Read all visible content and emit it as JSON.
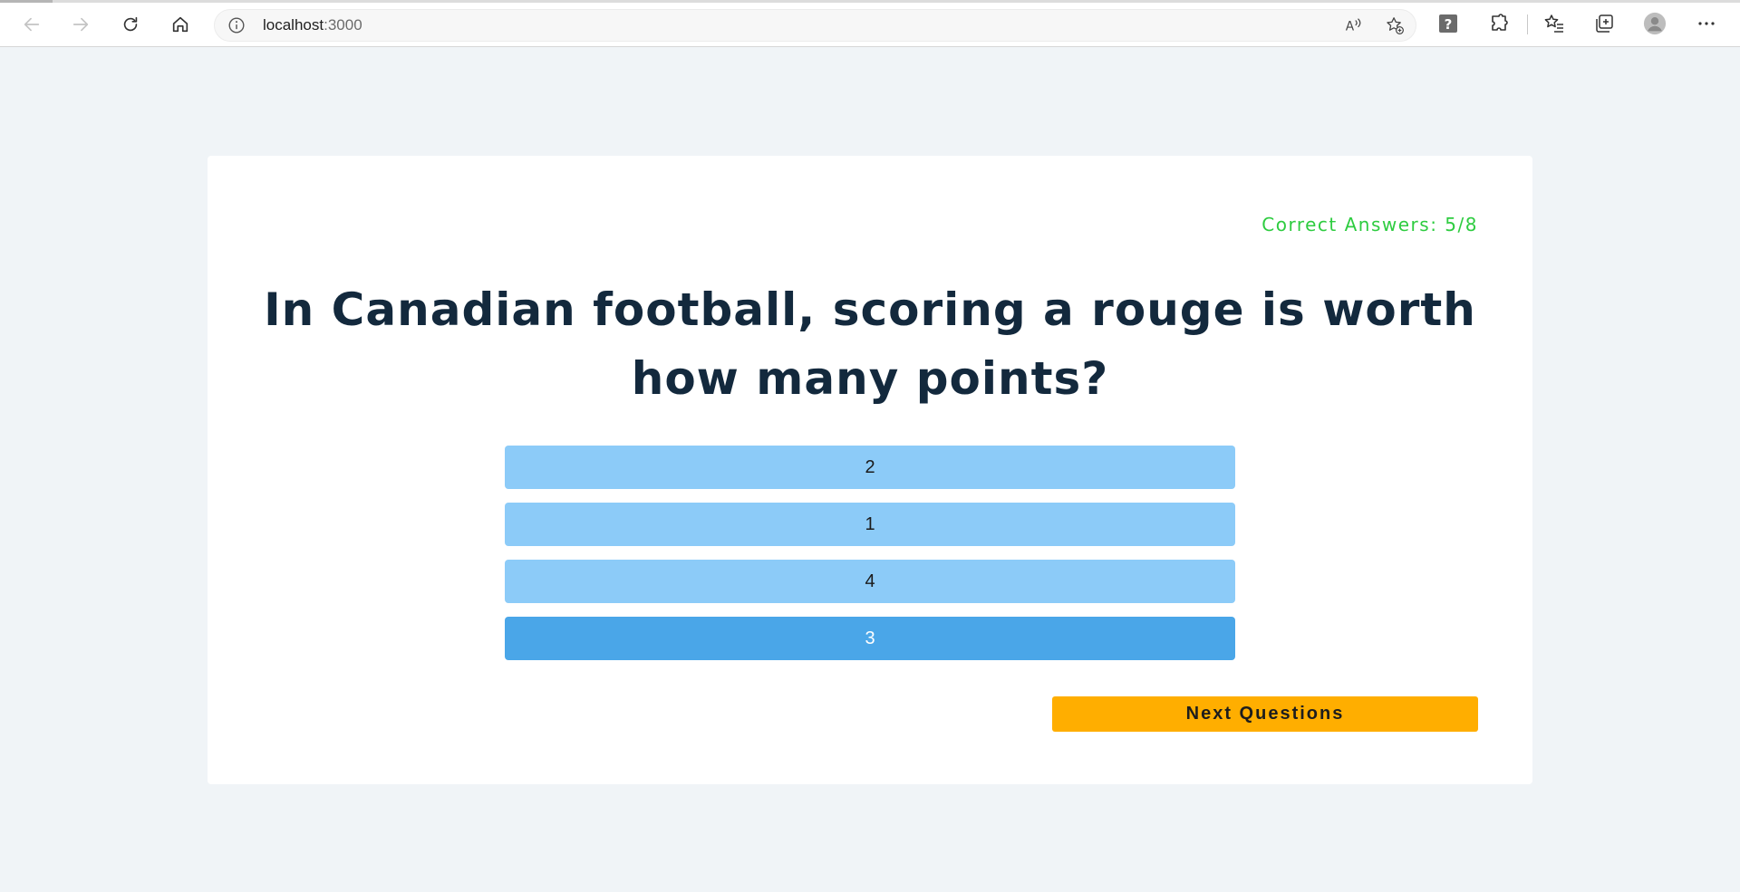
{
  "browser": {
    "url_host": "localhost",
    "url_port": ":3000",
    "icons": {
      "back": "back-arrow-icon",
      "forward": "forward-arrow-icon",
      "refresh": "refresh-icon",
      "home": "home-icon",
      "info": "info-icon",
      "read_aloud": "read-aloud-icon",
      "add_favorite": "add-favorite-icon",
      "help_extension": "help-extension-icon",
      "extensions": "puzzle-icon",
      "favorites": "favorites-list-icon",
      "collections": "collections-icon",
      "profile": "profile-avatar-icon",
      "menu": "more-menu-icon"
    },
    "colors": {
      "toolbar_bg": "#ffffff",
      "page_bg": "#f0f4f7"
    }
  },
  "quiz": {
    "score_text": "Correct Answers: 5/8",
    "question": "In Canadian football, scoring a rouge is worth how many points?",
    "answers": [
      {
        "label": "2",
        "selected": false
      },
      {
        "label": "1",
        "selected": false
      },
      {
        "label": "4",
        "selected": false
      },
      {
        "label": "3",
        "selected": true
      }
    ],
    "next_button": "Next Questions",
    "colors": {
      "score": "#2ecc40",
      "question": "#13293d",
      "answer_bg": "#8ccbf8",
      "answer_selected_bg": "#4aa6e8",
      "next_bg": "#ffae00"
    }
  }
}
